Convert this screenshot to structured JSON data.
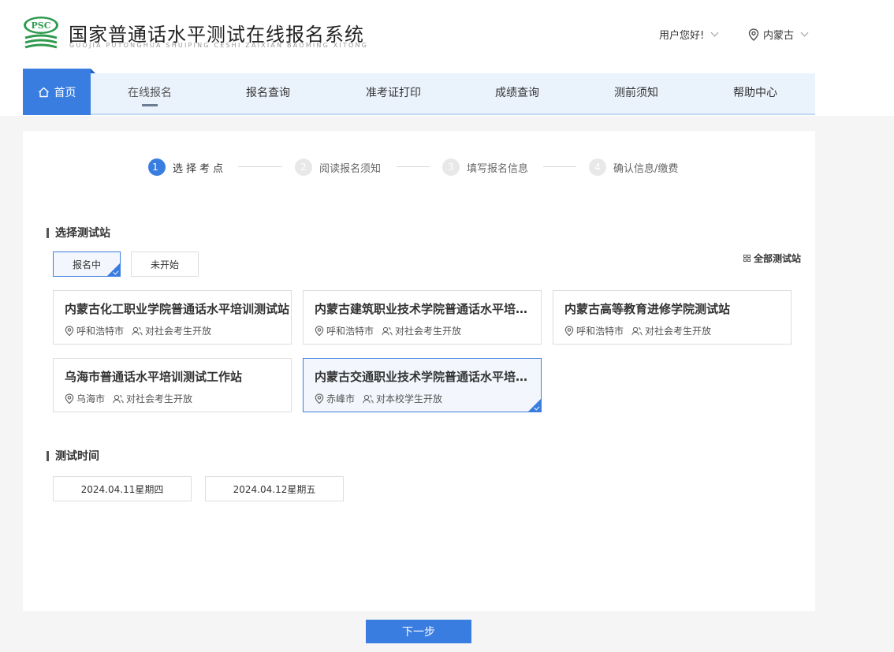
{
  "header": {
    "logo_text": "PSC",
    "title": "国家普通话水平测试在线报名系统",
    "subtitle": "GUOJIA PUTONGHUA SHUIPING CESHI ZAIXIAN BAOMING XITONG",
    "greeting": "用户您好!",
    "region": "内蒙古"
  },
  "nav": {
    "home": "首页",
    "items": [
      {
        "label": "在线报名",
        "active": true
      },
      {
        "label": "报名查询"
      },
      {
        "label": "准考证打印"
      },
      {
        "label": "成绩查询"
      },
      {
        "label": "测前须知"
      },
      {
        "label": "帮助中心"
      }
    ]
  },
  "steps": [
    {
      "num": "1",
      "label": "选择考点",
      "active": true
    },
    {
      "num": "2",
      "label": "阅读报名须知"
    },
    {
      "num": "3",
      "label": "填写报名信息"
    },
    {
      "num": "4",
      "label": "确认信息/缴费"
    }
  ],
  "station_section": {
    "title": "选择测试站",
    "tabs": [
      {
        "label": "报名中",
        "selected": true
      },
      {
        "label": "未开始"
      }
    ],
    "all_sites": "全部测试站",
    "stations": [
      {
        "name": "内蒙古化工职业学院普通话水平培训测试站",
        "city": "呼和浩特市",
        "open_to": "对社会考生开放"
      },
      {
        "name": "内蒙古建筑职业技术学院普通话水平培训测试站",
        "city": "呼和浩特市",
        "open_to": "对社会考生开放"
      },
      {
        "name": "内蒙古高等教育进修学院测试站",
        "city": "呼和浩特市",
        "open_to": "对社会考生开放"
      },
      {
        "name": "乌海市普通话水平培训测试工作站",
        "city": "乌海市",
        "open_to": "对社会考生开放"
      },
      {
        "name": "内蒙古交通职业技术学院普通话水平培训测试站",
        "city": "赤峰市",
        "open_to": "对本校学生开放",
        "selected": true
      }
    ]
  },
  "time_section": {
    "title": "测试时间",
    "dates": [
      "2024.04.11星期四",
      "2024.04.12星期五"
    ]
  },
  "next_button": "下一步",
  "colors": {
    "primary": "#3a7de0",
    "nav_bg": "#eaf2fc",
    "page_bg": "#f5f5f5"
  }
}
